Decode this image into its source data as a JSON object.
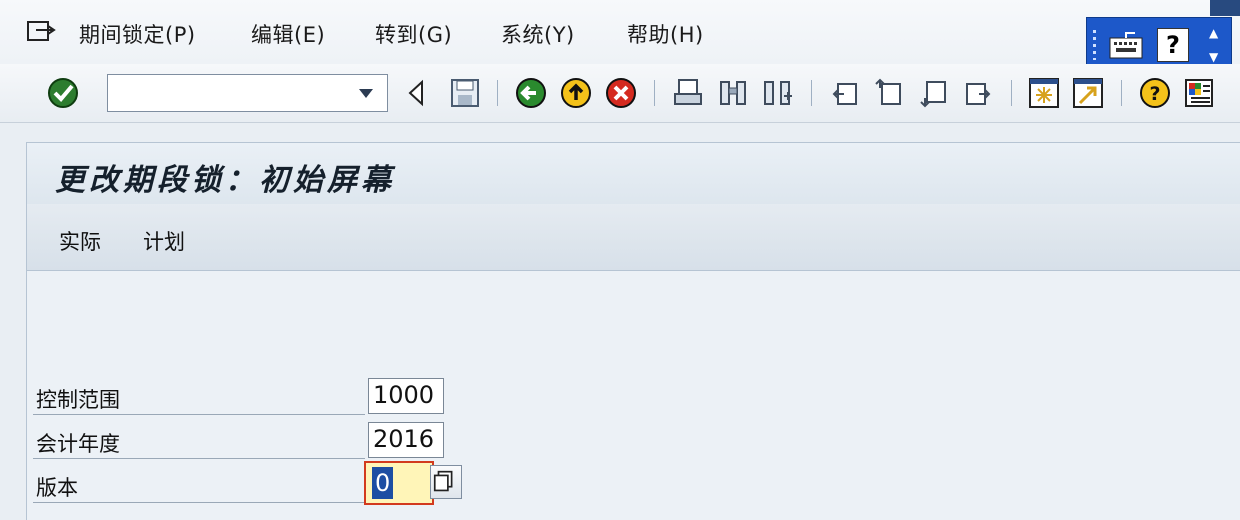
{
  "menu": {
    "items": [
      {
        "label": "期间锁定(P)"
      },
      {
        "label": "编辑(E)"
      },
      {
        "label": "转到(G)"
      },
      {
        "label": "系统(Y)"
      },
      {
        "label": "帮助(H)"
      }
    ]
  },
  "toolbar": {
    "command_value": "",
    "icons": [
      "enter-icon",
      "back-arrow-icon",
      "save-icon",
      "back-icon",
      "exit-icon",
      "cancel-icon",
      "print-icon",
      "find-icon",
      "find-next-icon",
      "first-page-icon",
      "previous-page-icon",
      "next-page-icon",
      "last-page-icon",
      "create-session-icon",
      "create-shortcut-icon",
      "help-icon",
      "layout-menu-icon"
    ]
  },
  "system_box": {
    "help_glyph": "?"
  },
  "page": {
    "title": "更改期段锁：初始屏幕"
  },
  "app_toolbar": {
    "actual": "实际",
    "plan": "计划"
  },
  "form": {
    "controlling_area": {
      "label": "控制范围",
      "value": "1000"
    },
    "fiscal_year": {
      "label": "会计年度",
      "value": "2016"
    },
    "version": {
      "label": "版本",
      "value": "0"
    }
  },
  "colors": {
    "system_box": "#1d58c9",
    "active_field": "#fff5b8",
    "active_border": "#d23a1e",
    "selection": "#1d4ea3"
  }
}
